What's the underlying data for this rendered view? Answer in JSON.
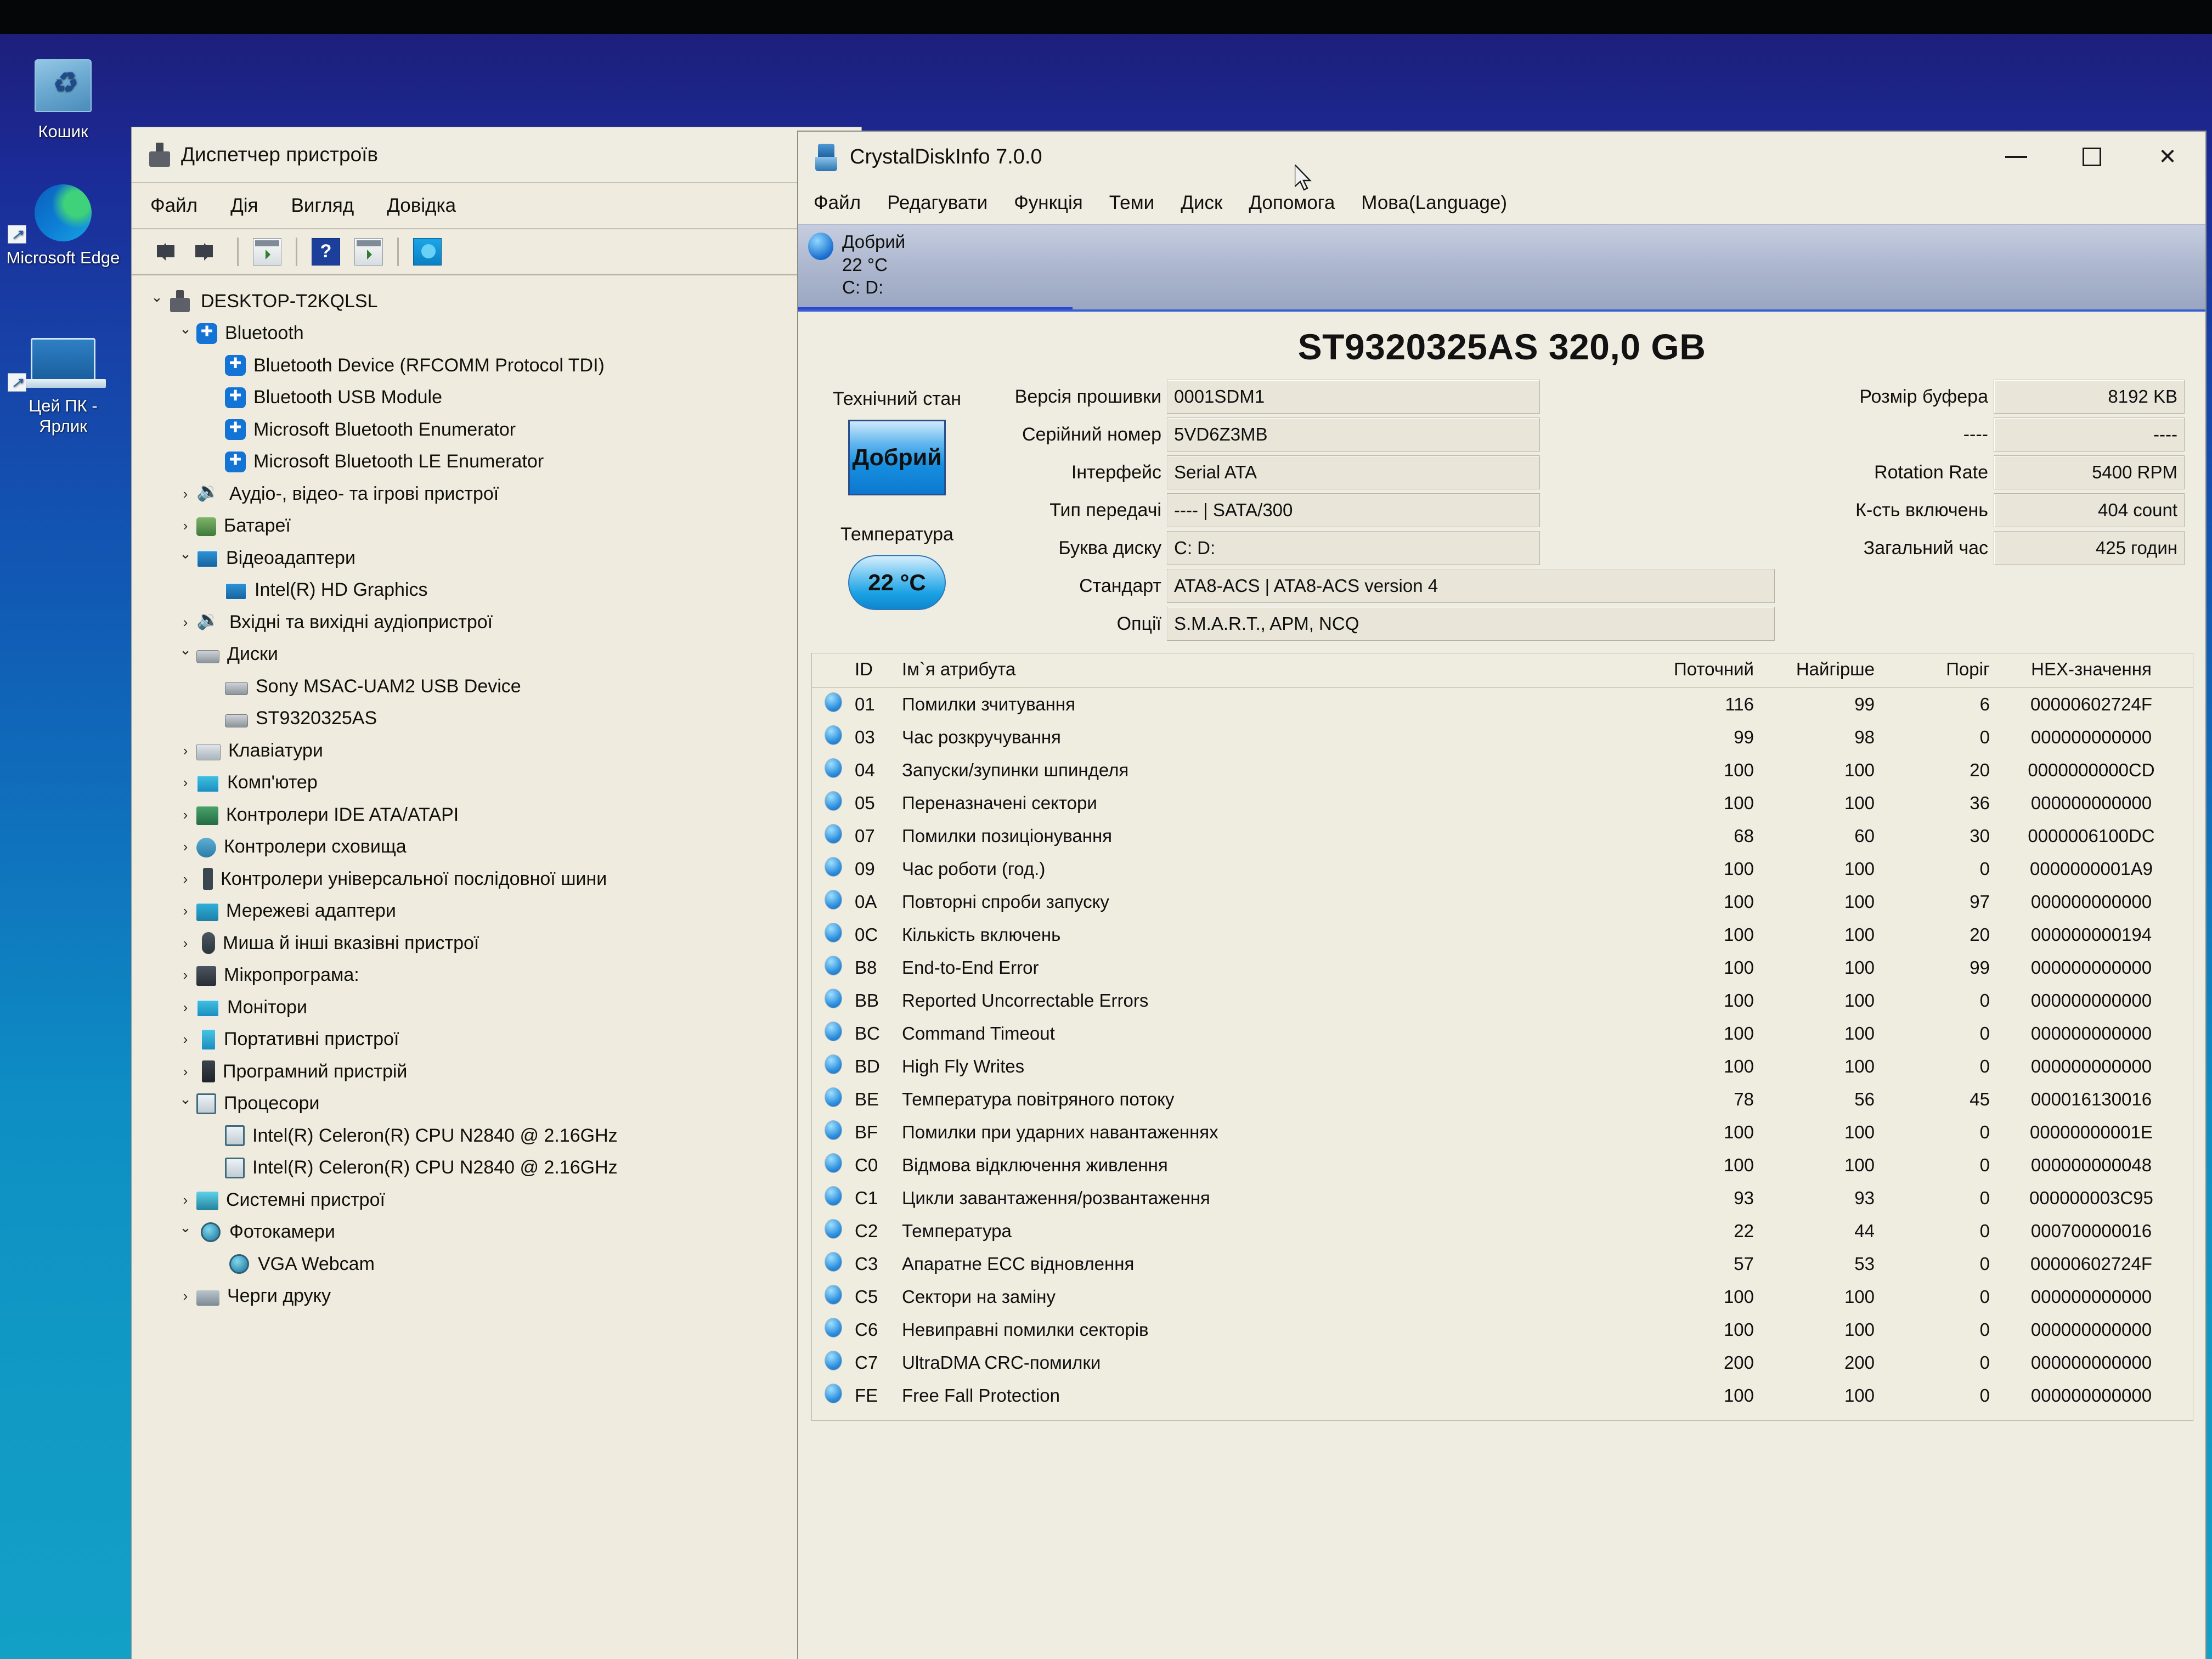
{
  "desktop": {
    "icons": [
      {
        "label": "Кошик",
        "icon": "recycle-bin-icon"
      },
      {
        "label": "Microsoft Edge",
        "icon": "edge-icon"
      },
      {
        "label": "Цей ПК - Ярлик",
        "icon": "this-pc-icon"
      }
    ]
  },
  "device_manager": {
    "title": "Диспетчер пристроїв",
    "menu": [
      "Файл",
      "Дія",
      "Вигляд",
      "Довідка"
    ],
    "toolbar": [
      "back-arrow",
      "forward-arrow",
      "properties",
      "help",
      "update-driver",
      "scan-hardware"
    ],
    "tree": [
      {
        "label": "DESKTOP-T2KQLSL",
        "depth": 1,
        "state": "open",
        "icon": "computer"
      },
      {
        "label": "Bluetooth",
        "depth": 2,
        "state": "open",
        "icon": "bt"
      },
      {
        "label": "Bluetooth Device (RFCOMM Protocol TDI)",
        "depth": 3,
        "state": "none",
        "icon": "bt"
      },
      {
        "label": "Bluetooth USB Module",
        "depth": 3,
        "state": "none",
        "icon": "bt"
      },
      {
        "label": "Microsoft Bluetooth Enumerator",
        "depth": 3,
        "state": "none",
        "icon": "bt"
      },
      {
        "label": "Microsoft Bluetooth LE Enumerator",
        "depth": 3,
        "state": "none",
        "icon": "bt"
      },
      {
        "label": "Аудіо-, відео- та ігрові пристрої",
        "depth": 2,
        "state": "closed",
        "icon": "audio"
      },
      {
        "label": "Батареї",
        "depth": 2,
        "state": "closed",
        "icon": "battery"
      },
      {
        "label": "Відеоадаптери",
        "depth": 2,
        "state": "open",
        "icon": "video"
      },
      {
        "label": "Intel(R) HD Graphics",
        "depth": 3,
        "state": "none",
        "icon": "video"
      },
      {
        "label": "Вхідні та вихідні аудіопристрої",
        "depth": 2,
        "state": "closed",
        "icon": "audio"
      },
      {
        "label": "Диски",
        "depth": 2,
        "state": "open",
        "icon": "disk"
      },
      {
        "label": "Sony MSAC-UAM2 USB Device",
        "depth": 3,
        "state": "none",
        "icon": "disk"
      },
      {
        "label": "ST9320325AS",
        "depth": 3,
        "state": "none",
        "icon": "disk"
      },
      {
        "label": "Клавіатури",
        "depth": 2,
        "state": "closed",
        "icon": "kbd"
      },
      {
        "label": "Комп'ютер",
        "depth": 2,
        "state": "closed",
        "icon": "monitor"
      },
      {
        "label": "Контролери IDE ATA/ATAPI",
        "depth": 2,
        "state": "closed",
        "icon": "ide"
      },
      {
        "label": "Контролери сховища",
        "depth": 2,
        "state": "closed",
        "icon": "storage"
      },
      {
        "label": "Контролери універсальної послідовної шини",
        "depth": 2,
        "state": "closed",
        "icon": "usb"
      },
      {
        "label": "Мережеві адаптери",
        "depth": 2,
        "state": "closed",
        "icon": "net"
      },
      {
        "label": "Миша й інші вказівні пристрої",
        "depth": 2,
        "state": "closed",
        "icon": "mouse"
      },
      {
        "label": "Мікропрограма:",
        "depth": 2,
        "state": "closed",
        "icon": "chip"
      },
      {
        "label": "Монітори",
        "depth": 2,
        "state": "closed",
        "icon": "monitor"
      },
      {
        "label": "Портативні пристрої",
        "depth": 2,
        "state": "closed",
        "icon": "portable"
      },
      {
        "label": "Програмний пристрій",
        "depth": 2,
        "state": "closed",
        "icon": "soft"
      },
      {
        "label": "Процесори",
        "depth": 2,
        "state": "open",
        "icon": "cpu"
      },
      {
        "label": "Intel(R) Celeron(R) CPU  N2840  @ 2.16GHz",
        "depth": 3,
        "state": "none",
        "icon": "cpu"
      },
      {
        "label": "Intel(R) Celeron(R) CPU  N2840  @ 2.16GHz",
        "depth": 3,
        "state": "none",
        "icon": "cpu"
      },
      {
        "label": "Системні пристрої",
        "depth": 2,
        "state": "closed",
        "icon": "sys"
      },
      {
        "label": "Фотокамери",
        "depth": 2,
        "state": "open",
        "icon": "cam"
      },
      {
        "label": "VGA Webcam",
        "depth": 3,
        "state": "none",
        "icon": "cam"
      },
      {
        "label": "Черги друку",
        "depth": 2,
        "state": "closed",
        "icon": "print"
      }
    ]
  },
  "crystaldiskinfo": {
    "title": "CrystalDiskInfo 7.0.0",
    "menu": [
      "Файл",
      "Редагувати",
      "Функція",
      "Теми",
      "Диск",
      "Допомога",
      "Мова(Language)"
    ],
    "window_buttons": {
      "minimize": "minimize-button",
      "maximize": "maximize-button",
      "close": "close-button"
    },
    "diskbar": {
      "health": "Добрий",
      "temperature": "22 °C",
      "letters": "C: D:"
    },
    "model_title": "ST9320325AS 320,0 GB",
    "gauges": {
      "health_label": "Технічний стан",
      "health_value": "Добрий",
      "temp_label": "Температура",
      "temp_value": "22 °C"
    },
    "fields_mid": [
      {
        "label": "Версія прошивки",
        "value": "0001SDM1",
        "wide": false
      },
      {
        "label": "Серійний номер",
        "value": "5VD6Z3MB",
        "wide": false
      },
      {
        "label": "Інтерфейс",
        "value": "Serial ATA",
        "wide": false
      },
      {
        "label": "Тип передачі",
        "value": "---- | SATA/300",
        "wide": false
      },
      {
        "label": "Буква диску",
        "value": "C: D:",
        "wide": false
      },
      {
        "label": "Стандарт",
        "value": "ATA8-ACS | ATA8-ACS version 4",
        "wide": true
      },
      {
        "label": "Опції",
        "value": "S.M.A.R.T., APM, NCQ",
        "wide": true
      }
    ],
    "fields_right": [
      {
        "label": "Розмір буфера",
        "value": "8192 KB"
      },
      {
        "label": "----",
        "value": "----"
      },
      {
        "label": "Rotation Rate",
        "value": "5400 RPM"
      },
      {
        "label": "К-сть включень",
        "value": "404 count"
      },
      {
        "label": "Загальний час",
        "value": "425 годин"
      }
    ],
    "smart_table": {
      "headers": [
        "",
        "ID",
        "Ім`я атрибута",
        "Поточний",
        "Найгірше",
        "Поріг",
        "HEX-значення"
      ],
      "rows": [
        [
          "01",
          "Помилки зчитування",
          "116",
          "99",
          "6",
          "00000602724F"
        ],
        [
          "03",
          "Час розкручування",
          "99",
          "98",
          "0",
          "000000000000"
        ],
        [
          "04",
          "Запуски/зупинки шпинделя",
          "100",
          "100",
          "20",
          "0000000000CD"
        ],
        [
          "05",
          "Переназначені сектори",
          "100",
          "100",
          "36",
          "000000000000"
        ],
        [
          "07",
          "Помилки позиціонування",
          "68",
          "60",
          "30",
          "0000006100DC"
        ],
        [
          "09",
          "Час роботи (год.)",
          "100",
          "100",
          "0",
          "0000000001A9"
        ],
        [
          "0A",
          "Повторні спроби запуску",
          "100",
          "100",
          "97",
          "000000000000"
        ],
        [
          "0C",
          "Кількість включень",
          "100",
          "100",
          "20",
          "000000000194"
        ],
        [
          "B8",
          "End-to-End Error",
          "100",
          "100",
          "99",
          "000000000000"
        ],
        [
          "BB",
          "Reported Uncorrectable Errors",
          "100",
          "100",
          "0",
          "000000000000"
        ],
        [
          "BC",
          "Command Timeout",
          "100",
          "100",
          "0",
          "000000000000"
        ],
        [
          "BD",
          "High Fly Writes",
          "100",
          "100",
          "0",
          "000000000000"
        ],
        [
          "BE",
          "Температура повітряного потоку",
          "78",
          "56",
          "45",
          "000016130016"
        ],
        [
          "BF",
          "Помилки при ударних навантаженнях",
          "100",
          "100",
          "0",
          "00000000001E"
        ],
        [
          "C0",
          "Відмова відключення живлення",
          "100",
          "100",
          "0",
          "000000000048"
        ],
        [
          "C1",
          "Цикли завантаження/розвантаження",
          "93",
          "93",
          "0",
          "000000003C95"
        ],
        [
          "C2",
          "Температура",
          "22",
          "44",
          "0",
          "000700000016"
        ],
        [
          "C3",
          "Апаратне ECC відновлення",
          "57",
          "53",
          "0",
          "00000602724F"
        ],
        [
          "C5",
          "Сектори на заміну",
          "100",
          "100",
          "0",
          "000000000000"
        ],
        [
          "C6",
          "Невиправні помилки секторів",
          "100",
          "100",
          "0",
          "000000000000"
        ],
        [
          "C7",
          "UltraDMA CRC-помилки",
          "200",
          "200",
          "0",
          "000000000000"
        ],
        [
          "FE",
          "Free Fall Protection",
          "100",
          "100",
          "0",
          "000000000000"
        ]
      ]
    }
  },
  "colors": {
    "accent_blue": "#1a6fd0",
    "window_face": "#efece1",
    "desktop_top": "#1d1f7a",
    "desktop_bottom": "#12a0c6"
  }
}
